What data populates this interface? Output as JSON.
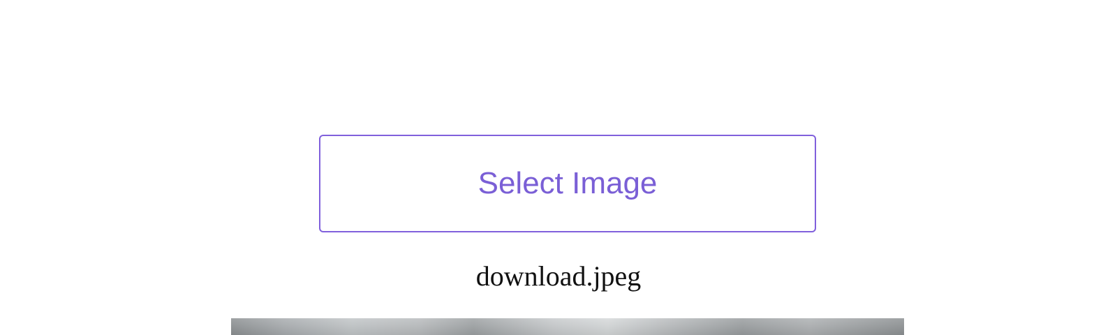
{
  "uploader": {
    "select_label": "Select Image",
    "filename": "download.jpeg"
  },
  "colors": {
    "accent": "#8060dc",
    "accent_text": "#7a5fd6",
    "text": "#111111",
    "background": "#ffffff"
  }
}
